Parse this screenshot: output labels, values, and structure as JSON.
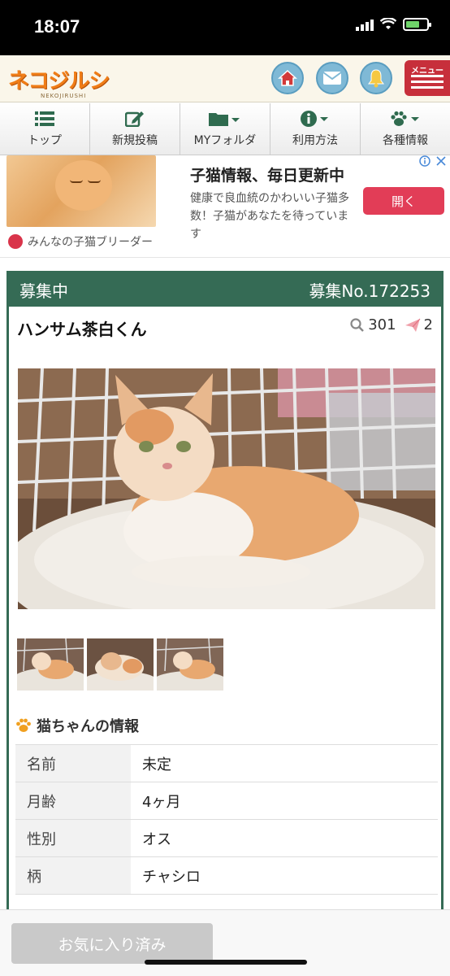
{
  "status_bar": {
    "time": "18:07"
  },
  "header": {
    "logo_text": "ネコジルシ",
    "logo_sub": "NEKOJIRUSHI",
    "menu_label": "メニュー",
    "icons": [
      "home-icon",
      "mail-icon",
      "bell-icon"
    ]
  },
  "nav": {
    "items": [
      {
        "label": "トップ",
        "icon": "list-icon"
      },
      {
        "label": "新規投稿",
        "icon": "edit-icon"
      },
      {
        "label": "MYフォルダ",
        "icon": "folder-icon"
      },
      {
        "label": "利用方法",
        "icon": "info-icon"
      },
      {
        "label": "各種情報",
        "icon": "paw-icon"
      }
    ]
  },
  "ad": {
    "title": "子猫情報、毎日更新中",
    "description": "健康で良血統のかわいい子猫多数！子猫があなたを待っています",
    "button": "開く",
    "brand": "みんなの子猫ブリーダー"
  },
  "listing": {
    "status": "募集中",
    "number": "募集No.172253",
    "name": "ハンサム茶白くん",
    "views": "301",
    "messages": "2"
  },
  "info_section": {
    "title": "猫ちゃんの情報",
    "rows": [
      {
        "label": "名前",
        "value": "未定"
      },
      {
        "label": "月齢",
        "value": "4ヶ月"
      },
      {
        "label": "性別",
        "value": "オス"
      },
      {
        "label": "柄",
        "value": "チャシロ"
      }
    ]
  },
  "bottom": {
    "favorite_button": "お気に入り済み"
  },
  "colors": {
    "accent_green": "#356b55",
    "menu_red": "#c72f3b",
    "ad_button": "#e23d57"
  }
}
